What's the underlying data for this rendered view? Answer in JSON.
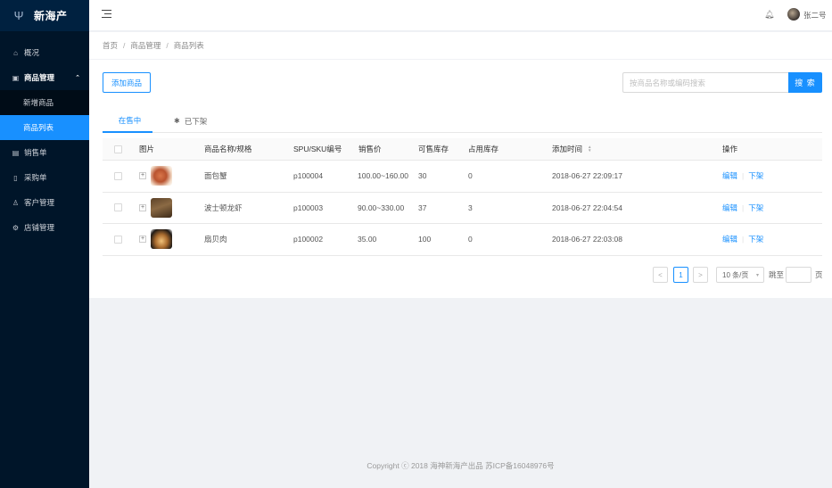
{
  "brand": {
    "name": "新海产",
    "logo_icon": "trident-icon"
  },
  "sidebar": {
    "items": [
      {
        "label": "概况",
        "icon": "home-icon"
      },
      {
        "label": "商品管理",
        "icon": "shop-icon",
        "open": true,
        "children": [
          {
            "label": "新增商品",
            "active": false
          },
          {
            "label": "商品列表",
            "active": true
          }
        ]
      },
      {
        "label": "销售单",
        "icon": "table-icon"
      },
      {
        "label": "采购单",
        "icon": "file-icon"
      },
      {
        "label": "客户管理",
        "icon": "user-icon"
      },
      {
        "label": "店铺管理",
        "icon": "setting-icon"
      }
    ]
  },
  "header": {
    "user_name": "张二号"
  },
  "breadcrumb": [
    "首页",
    "商品管理",
    "商品列表"
  ],
  "toolbar": {
    "add_label": "添加商品",
    "search_placeholder": "按商品名称或编码搜索",
    "search_label": "搜 索"
  },
  "tabs": [
    {
      "label": "在售中",
      "icon": "apple-icon",
      "active": true
    },
    {
      "label": "已下架",
      "icon": "android-icon",
      "active": false
    }
  ],
  "table": {
    "columns": [
      "图片",
      "商品名称/规格",
      "SPU/SKU编号",
      "销售价",
      "可售库存",
      "占用库存",
      "添加时间",
      "操作"
    ],
    "rows": [
      {
        "name": "面包蟹",
        "code": "p100004",
        "price": "100.00~160.00",
        "stock": "30",
        "reserved": "0",
        "added": "2018-06-27 22:09:17"
      },
      {
        "name": "波士顿龙虾",
        "code": "p100003",
        "price": "90.00~330.00",
        "stock": "37",
        "reserved": "3",
        "added": "2018-06-27 22:04:54"
      },
      {
        "name": "扇贝肉",
        "code": "p100002",
        "price": "35.00",
        "stock": "100",
        "reserved": "0",
        "added": "2018-06-27 22:03:08"
      }
    ],
    "actions": {
      "edit": "编辑",
      "offline": "下架"
    },
    "expand_symbol": "+"
  },
  "pagination": {
    "prev": "<",
    "next": ">",
    "current": "1",
    "page_size": "10 条/页",
    "jump_prefix": "跳至",
    "jump_suffix": "页"
  },
  "footer": {
    "text": "Copyright ⓒ 2018 海神新海产出品 苏ICP备16048976号"
  },
  "colors": {
    "primary": "#1890ff",
    "sider": "#001529",
    "submenu": "#000c17"
  }
}
